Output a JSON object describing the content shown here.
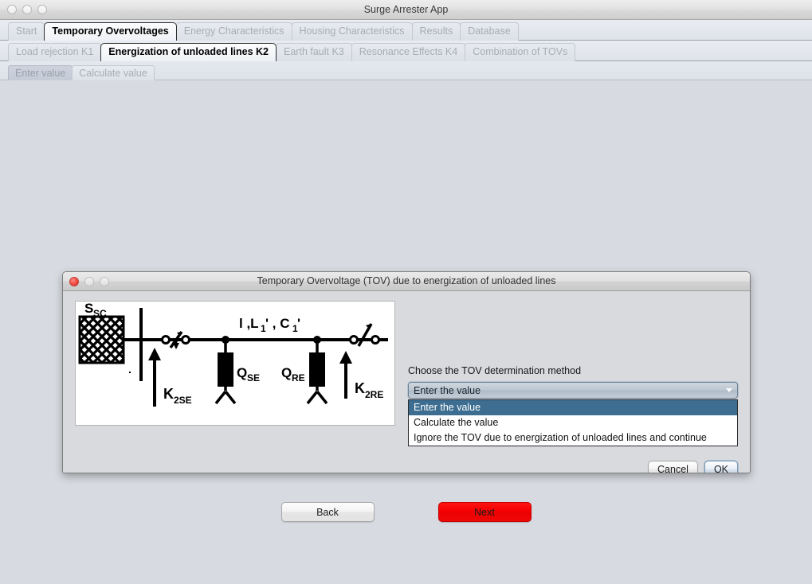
{
  "window": {
    "title": "Surge Arrester App",
    "traffic_lights": [
      "minimize-dot",
      "zoom-dot",
      "close-dot"
    ]
  },
  "primary_tabs": [
    {
      "label": "Start",
      "selected": false
    },
    {
      "label": "Temporary Overvoltages",
      "selected": true
    },
    {
      "label": "Energy Characteristics",
      "selected": false
    },
    {
      "label": "Housing Characteristics",
      "selected": false
    },
    {
      "label": "Results",
      "selected": false
    },
    {
      "label": "Database",
      "selected": false
    }
  ],
  "secondary_tabs": [
    {
      "label": "Load rejection K1",
      "selected": false
    },
    {
      "label": "Energization of unloaded lines K2",
      "selected": true
    },
    {
      "label": "Earth fault K3",
      "selected": false
    },
    {
      "label": "Resonance Effects K4",
      "selected": false
    },
    {
      "label": "Combination of TOVs",
      "selected": false
    }
  ],
  "tertiary_tabs": [
    {
      "label": "Enter value",
      "selected": true
    },
    {
      "label": "Calculate value",
      "selected": false
    }
  ],
  "footer": {
    "back_label": "Back",
    "next_label": "Next",
    "next_color": "#f40000"
  },
  "dialog": {
    "title": "Temporary Overvoltage (TOV) due to energization of unloaded lines",
    "method_label": "Choose the TOV determination method",
    "combo": {
      "selected": "Enter the value",
      "options": [
        "Enter the value",
        "Calculate the value",
        "Ignore the TOV due to energization of unloaded lines and continue"
      ],
      "highlighted_index": 0,
      "highlight_color": "#3d6e91"
    },
    "cancel_label": "Cancel",
    "ok_label": "OK",
    "figure": {
      "labels": {
        "source": "S",
        "source_sub": "SC",
        "line_params": "l ,L",
        "line_params_sub1": "1",
        "line_params_mid": "' , C",
        "line_params_sub2": "1",
        "line_params_end": "'",
        "q_se": "Q",
        "q_se_sub": "SE",
        "q_re": "Q",
        "q_re_sub": "RE",
        "k2se": "K",
        "k2se_sub": "2SE",
        "k2re": "K",
        "k2re_sub": "2RE"
      }
    }
  }
}
